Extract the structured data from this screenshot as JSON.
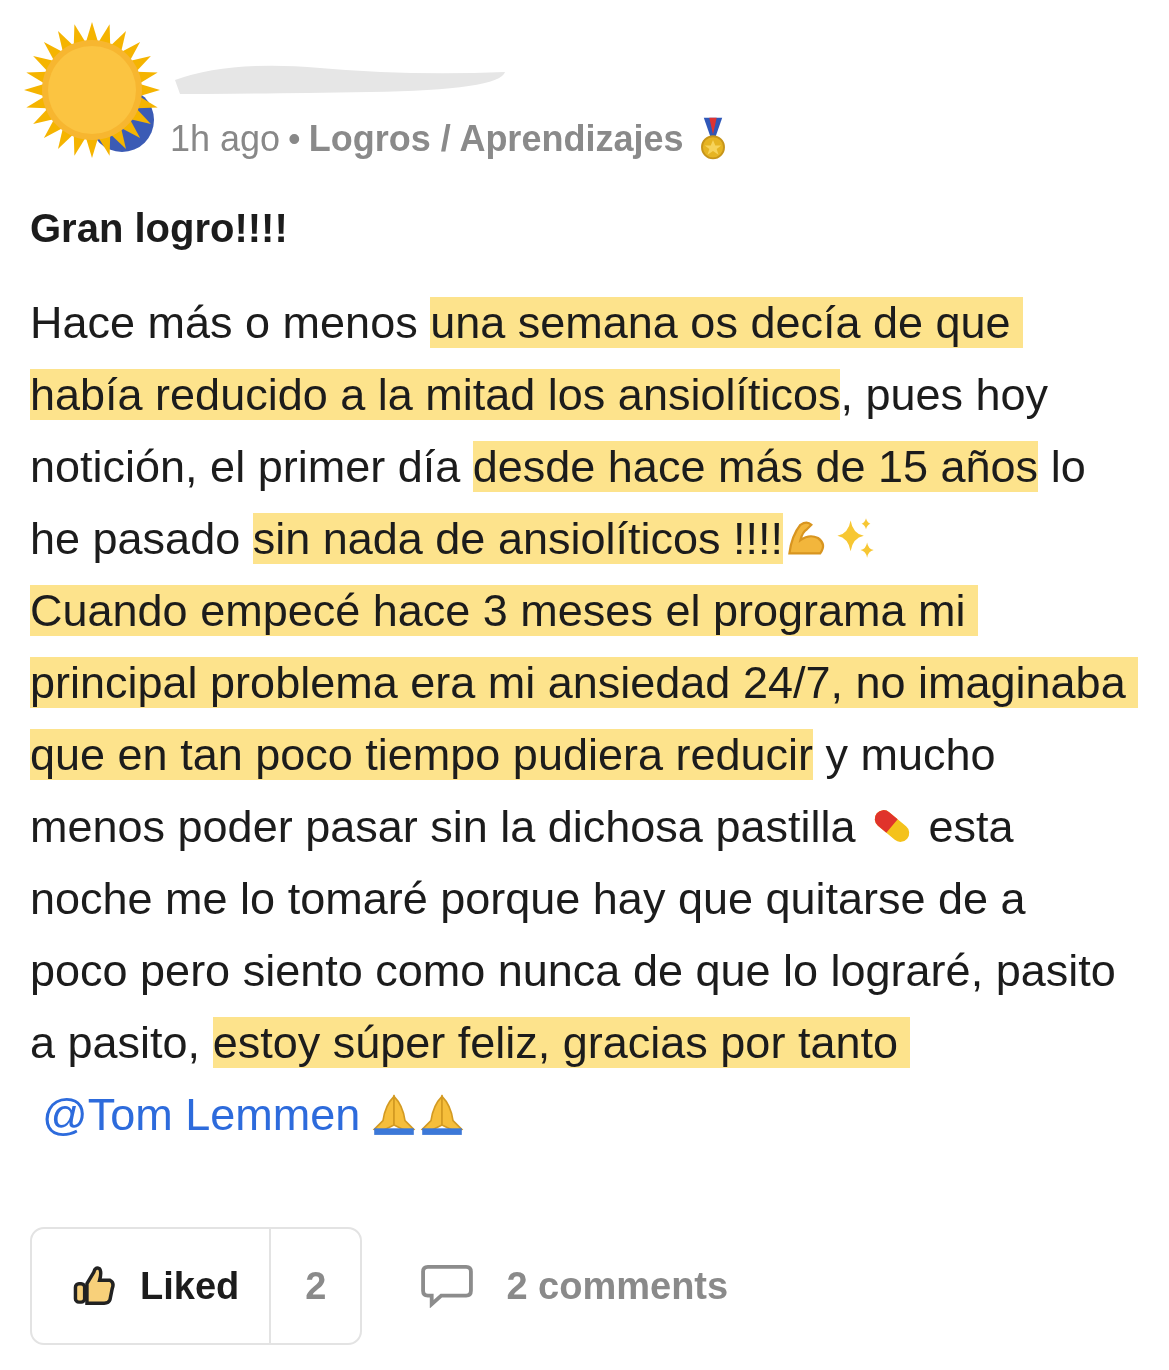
{
  "post": {
    "time": "1h ago",
    "separator": "•",
    "category": "Logros / Aprendizajes",
    "title": "Gran logro!!!!",
    "body": [
      {
        "kind": "text",
        "text": "Hace más o menos ",
        "highlighted": false
      },
      {
        "kind": "text",
        "text": "una semana os decía de que había reducido a la mitad los ansiolíticos",
        "highlighted": true
      },
      {
        "kind": "text",
        "text": ", pues hoy notición, el primer día ",
        "highlighted": false
      },
      {
        "kind": "text",
        "text": "desde hace más de 15 años",
        "highlighted": true
      },
      {
        "kind": "text",
        "text": " lo he pasado ",
        "highlighted": false
      },
      {
        "kind": "text",
        "text": "sin nada de ansiolíticos !!!!",
        "highlighted": true
      },
      {
        "kind": "icon"
      },
      {
        "kind": "icon"
      },
      {
        "kind": "text",
        "text": "\nCuando empecé hace 3 meses el programa mi principal problema era mi ansiedad 24/7, no imaginaba que en tan poco tiempo pudiera reducir",
        "highlighted": true
      },
      {
        "kind": "text",
        "text": " y mucho menos poder pasar sin la dichosa pastilla ",
        "highlighted": false
      },
      {
        "kind": "icon"
      },
      {
        "kind": "text",
        "text": " esta noche me lo tomaré porque hay que quitarse de a poco pero siento como nunca de que lo lograré, pasito a pasito, ",
        "highlighted": false
      },
      {
        "kind": "text",
        "text": "estoy súper feliz, gracias por tanto ",
        "highlighted": true
      },
      {
        "kind": "mention",
        "text": "@Tom Lemmen",
        "highlighted": false
      },
      {
        "kind": "icon"
      },
      {
        "kind": "icon"
      }
    ]
  },
  "actions": {
    "like": {
      "label": "Liked",
      "count": "2",
      "liked": true
    },
    "comments": "2 comments"
  }
}
